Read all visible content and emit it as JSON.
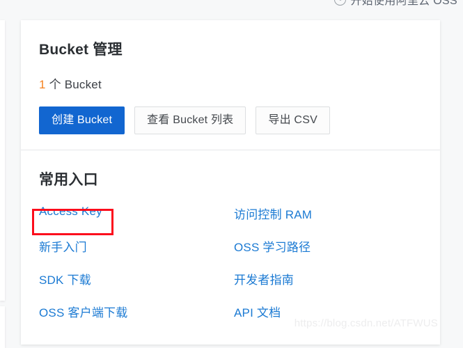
{
  "top_strip": {
    "icon": "info-circle-icon",
    "text": "开始使用阿里云 OSS"
  },
  "card": {
    "bucket_section": {
      "title": "Bucket 管理",
      "count_number": "1",
      "count_suffix": "个 Bucket",
      "buttons": [
        {
          "label": "创建 Bucket",
          "style": "primary"
        },
        {
          "label": "查看 Bucket 列表",
          "style": "default"
        },
        {
          "label": "导出 CSV",
          "style": "default"
        }
      ]
    },
    "entries_section": {
      "title": "常用入口",
      "links": [
        {
          "label": "Access Key",
          "highlighted": true
        },
        {
          "label": "访问控制 RAM",
          "highlighted": false
        },
        {
          "label": "新手入门",
          "highlighted": false
        },
        {
          "label": "OSS 学习路径",
          "highlighted": false
        },
        {
          "label": "SDK 下载",
          "highlighted": false
        },
        {
          "label": "开发者指南",
          "highlighted": false
        },
        {
          "label": "OSS 客户端下载",
          "highlighted": false
        },
        {
          "label": "API 文档",
          "highlighted": false
        }
      ]
    }
  },
  "watermark": {
    "text": "https://blog.csdn.net/ATFWUS"
  },
  "colors": {
    "primary_blue": "#1266d0",
    "link_blue": "#1b7ad3",
    "accent_orange": "#f5821f",
    "highlight_red": "#fc0d1c",
    "page_bg": "#f7f8f9",
    "card_bg": "#ffffff",
    "divider": "#e6e7e9"
  }
}
